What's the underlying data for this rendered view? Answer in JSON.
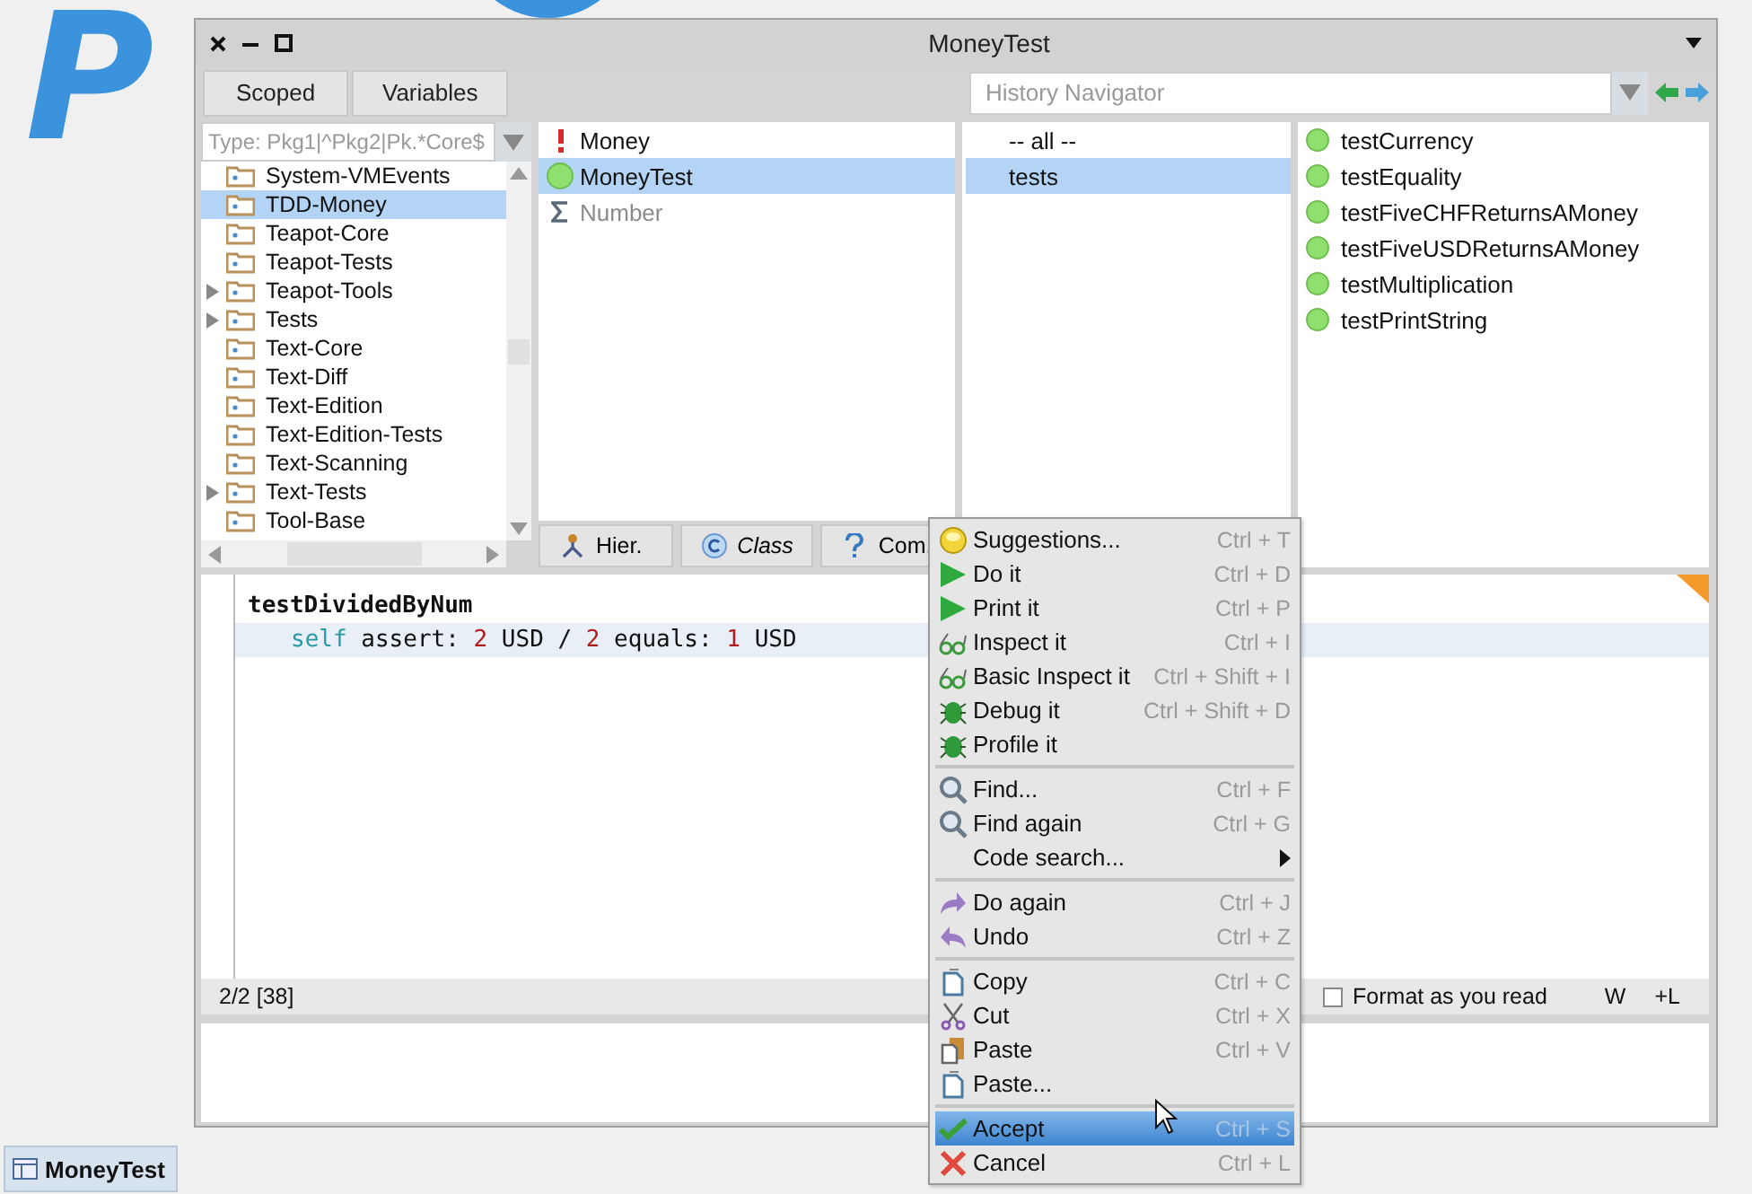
{
  "desktop": {
    "logo": "P"
  },
  "window": {
    "title": "MoneyTest"
  },
  "toolbar": {
    "buttons": [
      "Scoped",
      "Variables"
    ],
    "history": {
      "placeholder": "History Navigator"
    }
  },
  "package_filter": {
    "placeholder": "Type: Pkg1|^Pkg2|Pk.*Core$"
  },
  "packages": [
    {
      "label": "System-VMEvents",
      "expandable": false,
      "selected": false
    },
    {
      "label": "TDD-Money",
      "expandable": false,
      "selected": true
    },
    {
      "label": "Teapot-Core",
      "expandable": false,
      "selected": false
    },
    {
      "label": "Teapot-Tests",
      "expandable": false,
      "selected": false
    },
    {
      "label": "Teapot-Tools",
      "expandable": true,
      "selected": false
    },
    {
      "label": "Tests",
      "expandable": true,
      "selected": false
    },
    {
      "label": "Text-Core",
      "expandable": false,
      "selected": false
    },
    {
      "label": "Text-Diff",
      "expandable": false,
      "selected": false
    },
    {
      "label": "Text-Edition",
      "expandable": false,
      "selected": false
    },
    {
      "label": "Text-Edition-Tests",
      "expandable": false,
      "selected": false
    },
    {
      "label": "Text-Scanning",
      "expandable": false,
      "selected": false
    },
    {
      "label": "Text-Tests",
      "expandable": true,
      "selected": false
    },
    {
      "label": "Tool-Base",
      "expandable": false,
      "selected": false
    }
  ],
  "classes": [
    {
      "name": "Money",
      "kind": "error",
      "selected": false,
      "greyed": false
    },
    {
      "name": "MoneyTest",
      "kind": "passed",
      "selected": true,
      "greyed": false
    },
    {
      "name": "Number",
      "kind": "trait",
      "selected": false,
      "greyed": true
    }
  ],
  "class_buttons": [
    {
      "label": "Hier.",
      "kind": "hierarchy"
    },
    {
      "label": "Class",
      "kind": "class"
    },
    {
      "label": "Com.",
      "kind": "comment"
    }
  ],
  "protocols": [
    {
      "label": "-- all --",
      "selected": false
    },
    {
      "label": "tests",
      "selected": true
    }
  ],
  "methods": [
    {
      "label": "testCurrency",
      "kind": "passed"
    },
    {
      "label": "testEquality",
      "kind": "passed"
    },
    {
      "label": "testFiveCHFReturnsAMoney",
      "kind": "passed"
    },
    {
      "label": "testFiveUSDReturnsAMoney",
      "kind": "passed"
    },
    {
      "label": "testMultiplication",
      "kind": "passed"
    },
    {
      "label": "testPrintString",
      "kind": "passed"
    }
  ],
  "editor": {
    "lines": [
      {
        "kind": "header",
        "current": false,
        "tokens": [
          {
            "text": "testDividedByNum",
            "kind": "selector"
          }
        ]
      },
      {
        "kind": "body",
        "current": true,
        "tokens": [
          {
            "text": "self",
            "kind": "pseudo"
          },
          {
            "text": " assert: ",
            "kind": "plain"
          },
          {
            "text": "2",
            "kind": "number"
          },
          {
            "text": " USD / ",
            "kind": "plain"
          },
          {
            "text": "2",
            "kind": "number"
          },
          {
            "text": " equals: ",
            "kind": "plain"
          },
          {
            "text": "1",
            "kind": "number"
          },
          {
            "text": " USD",
            "kind": "plain"
          }
        ]
      }
    ]
  },
  "status_bar": {
    "position": "2/2 [38]",
    "format_checkbox": {
      "label": "Format as you read",
      "checked": false
    },
    "buttons": [
      "W",
      "+L"
    ]
  },
  "context_menu": {
    "groups": [
      [
        {
          "label": "Suggestions...",
          "shortcut": "Ctrl + T",
          "kind": "bulb",
          "selected": false,
          "submenu": false
        },
        {
          "label": "Do it",
          "shortcut": "Ctrl + D",
          "kind": "play",
          "selected": false,
          "submenu": false
        },
        {
          "label": "Print it",
          "shortcut": "Ctrl + P",
          "kind": "play",
          "selected": false,
          "submenu": false
        },
        {
          "label": "Inspect it",
          "shortcut": "Ctrl + I",
          "kind": "glasses",
          "selected": false,
          "submenu": false
        },
        {
          "label": "Basic Inspect it",
          "shortcut": "Ctrl + Shift + I",
          "kind": "glasses",
          "selected": false,
          "submenu": false
        },
        {
          "label": "Debug it",
          "shortcut": "Ctrl + Shift + D",
          "kind": "bug",
          "selected": false,
          "submenu": false
        },
        {
          "label": "Profile it",
          "kind": "bug",
          "selected": false,
          "submenu": false
        }
      ],
      [
        {
          "label": "Find...",
          "shortcut": "Ctrl + F",
          "kind": "magnifier",
          "selected": false,
          "submenu": false
        },
        {
          "label": "Find again",
          "shortcut": "Ctrl + G",
          "kind": "magnifier",
          "selected": false,
          "submenu": false
        },
        {
          "label": "Code search...",
          "selected": false,
          "submenu": true
        }
      ],
      [
        {
          "label": "Do again",
          "shortcut": "Ctrl + J",
          "kind": "redo",
          "selected": false,
          "submenu": false
        },
        {
          "label": "Undo",
          "shortcut": "Ctrl + Z",
          "kind": "undo",
          "selected": false,
          "submenu": false
        }
      ],
      [
        {
          "label": "Copy",
          "shortcut": "Ctrl + C",
          "kind": "copy",
          "selected": false,
          "submenu": false
        },
        {
          "label": "Cut",
          "shortcut": "Ctrl + X",
          "kind": "scissors",
          "selected": false,
          "submenu": false
        },
        {
          "label": "Paste",
          "shortcut": "Ctrl + V",
          "kind": "paste",
          "selected": false,
          "submenu": false
        },
        {
          "label": "Paste...",
          "kind": "copy",
          "selected": false,
          "submenu": false
        }
      ],
      [
        {
          "label": "Accept",
          "shortcut": "Ctrl + S",
          "kind": "check",
          "selected": true,
          "submenu": false
        },
        {
          "label": "Cancel",
          "shortcut": "Ctrl + L",
          "kind": "cross",
          "selected": false,
          "submenu": false
        }
      ]
    ]
  },
  "taskbar": [
    {
      "label": "MoneyTest",
      "selected": true
    }
  ]
}
